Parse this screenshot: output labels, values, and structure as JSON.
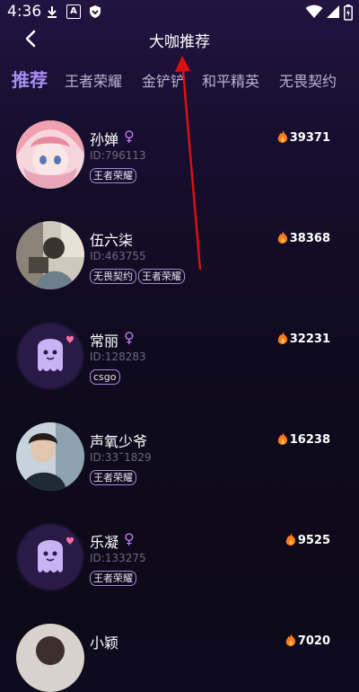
{
  "status_bar": {
    "time": "4:36"
  },
  "header": {
    "title": "大咖推荐"
  },
  "tabs": [
    {
      "label": "推荐"
    },
    {
      "label": "王者荣耀"
    },
    {
      "label": "金铲铲"
    },
    {
      "label": "和平精英"
    },
    {
      "label": "无畏契约"
    }
  ],
  "players": [
    {
      "name": "孙婵",
      "gender": "♀",
      "id": "ID:796113",
      "tags": [
        "王者荣耀"
      ],
      "heat": "39371"
    },
    {
      "name": "伍六柒",
      "gender": "",
      "id": "ID:463755",
      "tags": [
        "无畏契约",
        "王者荣耀"
      ],
      "heat": "38368"
    },
    {
      "name": "常丽",
      "gender": "♀",
      "id": "ID:128283",
      "tags": [
        "csgo"
      ],
      "heat": "32231"
    },
    {
      "name": "声氧少爷",
      "gender": "",
      "id": "ID:33˘1829",
      "tags": [
        "王者荣耀"
      ],
      "heat": "16238"
    },
    {
      "name": "乐凝",
      "gender": "♀",
      "id": "ID:133275",
      "tags": [
        "王者荣耀"
      ],
      "heat": "9525"
    },
    {
      "name": "小颖",
      "gender": "",
      "id": "",
      "tags": [],
      "heat": "7020"
    }
  ],
  "colors": {
    "accent": "#a98ef2",
    "gender_female": "#c07bf5",
    "flame": "#ff7a1a",
    "annotation_arrow": "#e01010"
  }
}
